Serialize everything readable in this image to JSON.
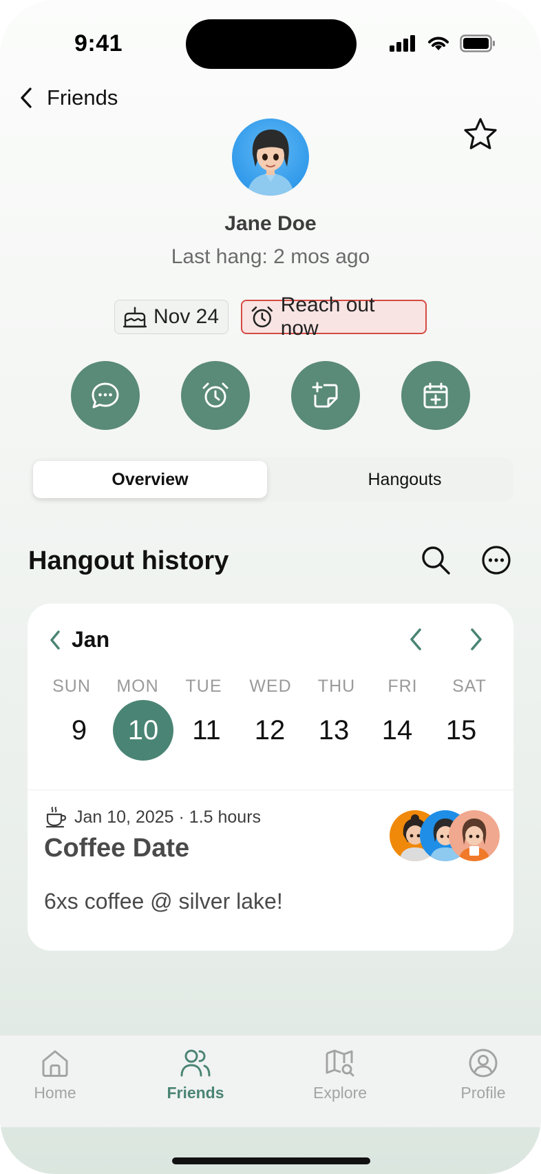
{
  "status_bar": {
    "time": "9:41"
  },
  "nav": {
    "back_label": "Friends"
  },
  "profile": {
    "name": "Jane Doe",
    "last_hang": "Last hang: 2 mos ago",
    "birthday_chip": "Nov 24",
    "reach_out_chip": "Reach out now"
  },
  "actions": [
    {
      "icon": "message-icon"
    },
    {
      "icon": "alarm-icon"
    },
    {
      "icon": "add-note-icon"
    },
    {
      "icon": "add-calendar-icon"
    }
  ],
  "segmented": {
    "tabs": [
      "Overview",
      "Hangouts"
    ],
    "selected": "Overview"
  },
  "history": {
    "title": "Hangout history",
    "calendar": {
      "month": "Jan",
      "weekdays": [
        "SUN",
        "MON",
        "TUE",
        "WED",
        "THU",
        "FRI",
        "SAT"
      ],
      "days": [
        "9",
        "10",
        "11",
        "12",
        "13",
        "14",
        "15"
      ],
      "selected_day": "10"
    },
    "entry": {
      "meta": "Jan 10, 2025 · 1.5 hours",
      "title": "Coffee Date",
      "note": "6xs coffee @ silver lake!",
      "icon": "coffee-icon"
    }
  },
  "tabbar": {
    "items": [
      {
        "label": "Home",
        "icon": "home-icon"
      },
      {
        "label": "Friends",
        "icon": "friends-icon"
      },
      {
        "label": "Explore",
        "icon": "map-search-icon"
      },
      {
        "label": "Profile",
        "icon": "profile-icon"
      }
    ],
    "active": "Friends"
  },
  "colors": {
    "accent": "#4a8474",
    "action_button": "#5a8a78",
    "reach_out_border": "#d44a42",
    "reach_out_bg": "#f8e4e2"
  }
}
